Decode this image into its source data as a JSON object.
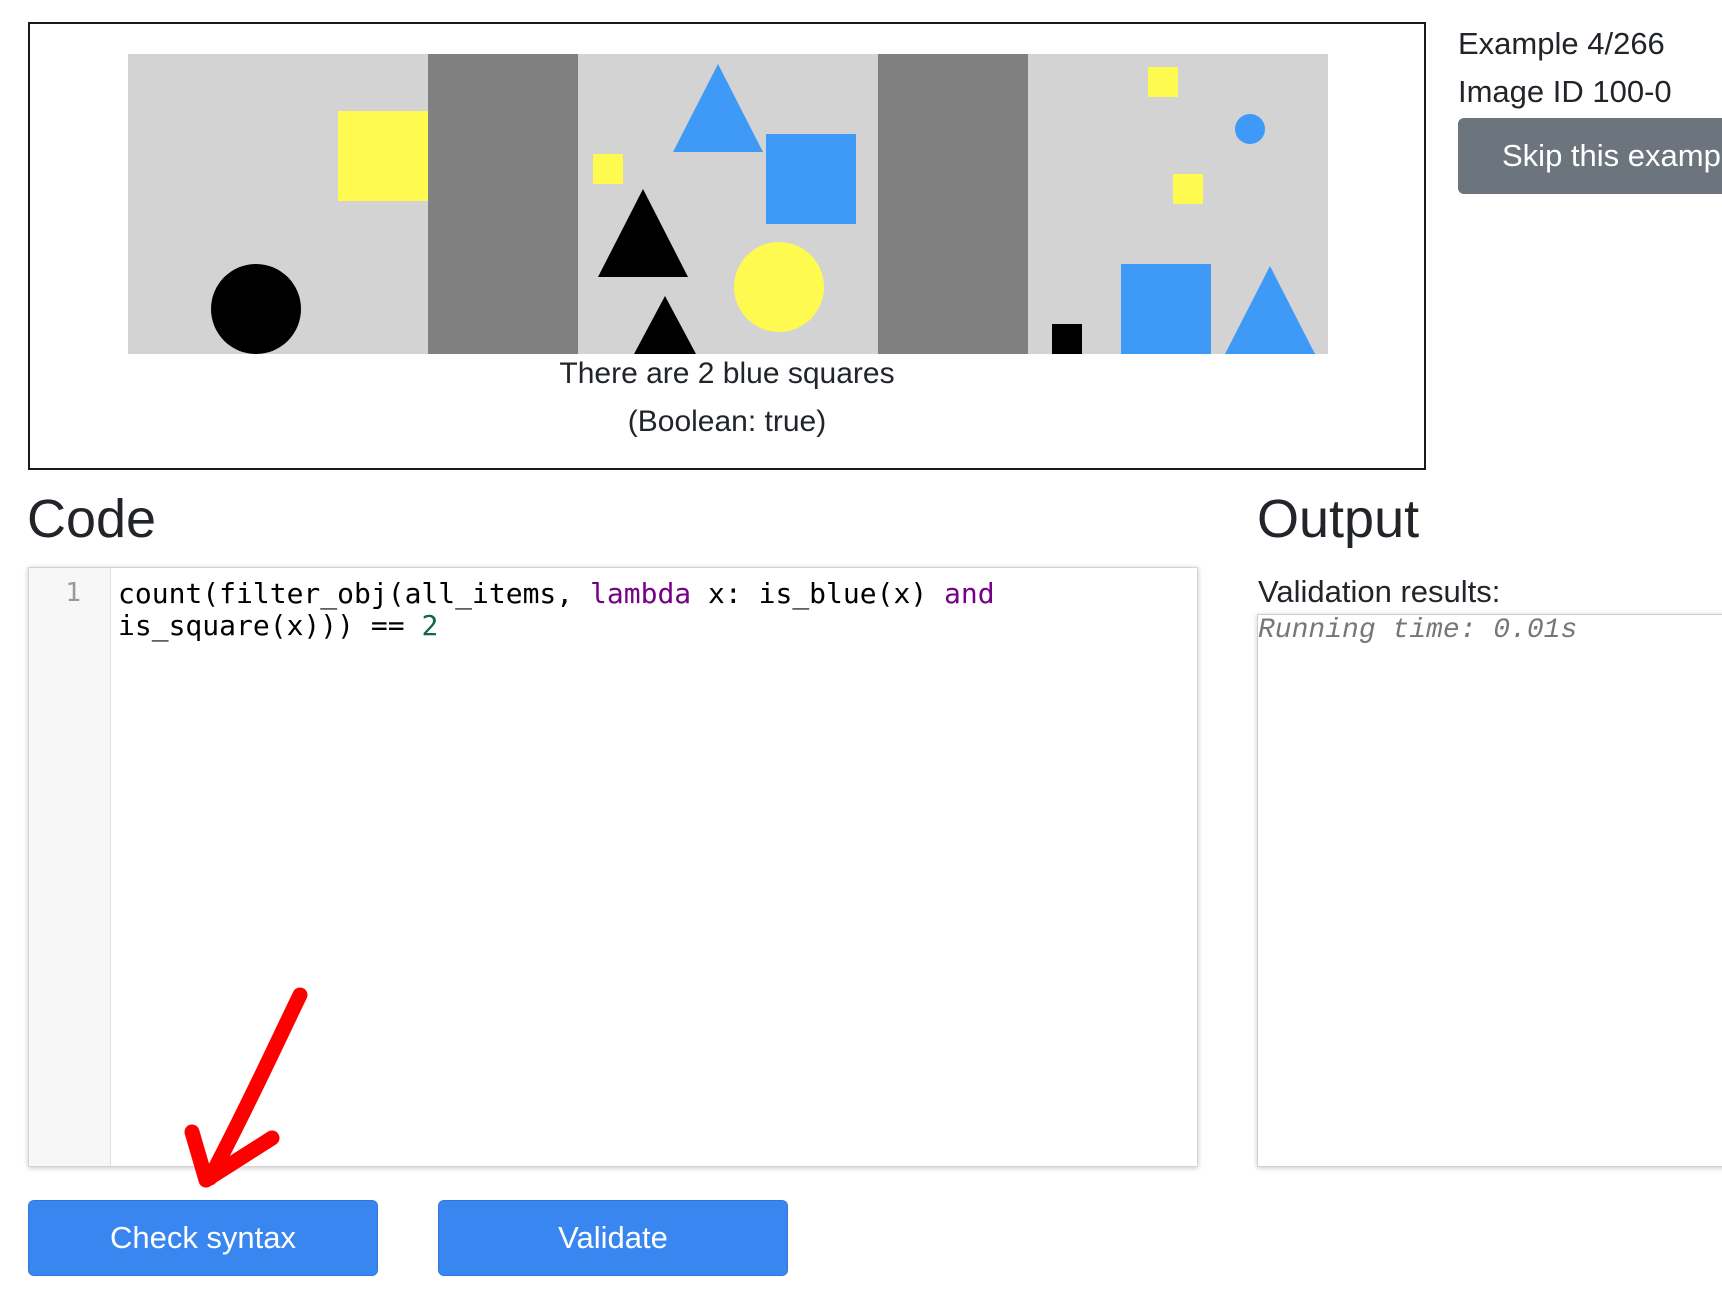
{
  "example_panel": {
    "caption": "There are 2 blue squares",
    "answer": "(Boolean: true)"
  },
  "meta": {
    "example_counter": "Example 4/266",
    "image_id": "Image ID 100-0",
    "skip_label": "Skip this examp"
  },
  "code_section": {
    "heading": "Code",
    "line_number": "1",
    "tokens": {
      "t1": "count(filter_obj(all_items, ",
      "t2": "lambda",
      "t3": " x: is_blue(x) ",
      "t4": "and",
      "t5": "is_square(x))) == ",
      "t6": "2"
    }
  },
  "output_section": {
    "heading": "Output",
    "validation_label": "Validation results:",
    "running_time": "Running time: 0.01s"
  },
  "buttons": {
    "check_syntax": "Check syntax",
    "validate": "Validate"
  },
  "colors": {
    "primary": "#3a86f0",
    "secondary": "#6c757d",
    "keyword": "#770088",
    "number": "#116644",
    "shape_blue": "#3f9af7",
    "shape_yellow": "#fffa50",
    "panel_gray": "#d3d3d3",
    "divider_gray": "#808080",
    "annotation_red": "#ff0000"
  }
}
